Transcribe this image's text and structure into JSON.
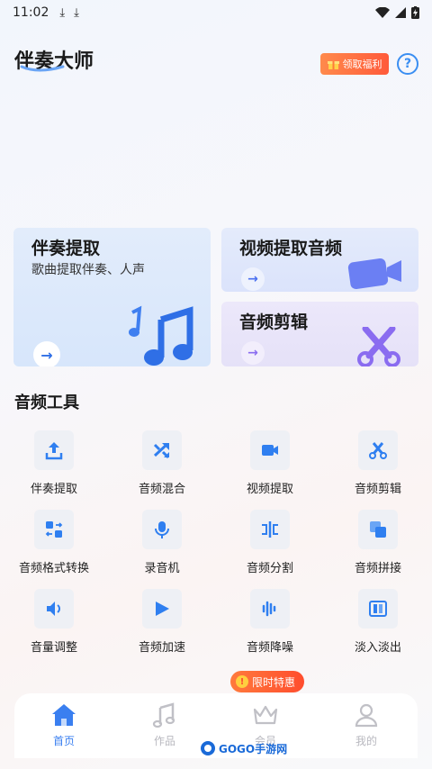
{
  "status_bar": {
    "time": "11:02"
  },
  "header": {
    "title": "伴奏大师",
    "welfare_label": "领取福利",
    "help_label": "?"
  },
  "feature_cards": [
    {
      "title": "伴奏提取",
      "subtitle": "歌曲提取伴奏、人声"
    },
    {
      "title": "视频提取音频"
    },
    {
      "title": "音频剪辑"
    }
  ],
  "tools_section": {
    "title": "音频工具",
    "items": [
      {
        "label": "伴奏提取",
        "icon": "upload-icon"
      },
      {
        "label": "音频混合",
        "icon": "shuffle-icon"
      },
      {
        "label": "视频提取",
        "icon": "video-camera-icon"
      },
      {
        "label": "音频剪辑",
        "icon": "scissors-icon"
      },
      {
        "label": "音频格式转换",
        "icon": "format-convert-icon"
      },
      {
        "label": "录音机",
        "icon": "microphone-icon"
      },
      {
        "label": "音频分割",
        "icon": "split-icon"
      },
      {
        "label": "音频拼接",
        "icon": "merge-icon"
      },
      {
        "label": "音量调整",
        "icon": "volume-icon"
      },
      {
        "label": "音频加速",
        "icon": "speed-icon"
      },
      {
        "label": "音频降噪",
        "icon": "denoise-icon"
      },
      {
        "label": "淡入淡出",
        "icon": "fade-icon"
      }
    ]
  },
  "promo_badge": "限时特惠",
  "tab_bar": [
    {
      "label": "首页",
      "icon": "home-icon",
      "active": true
    },
    {
      "label": "作品",
      "icon": "music-note-icon",
      "active": false
    },
    {
      "label": "会员",
      "icon": "crown-icon",
      "active": false
    },
    {
      "label": "我的",
      "icon": "user-icon",
      "active": false
    }
  ],
  "watermark": "GOGO手游网",
  "colors": {
    "accent": "#3a7ff0",
    "promo": "#ff5a3a",
    "icon_blue": "#2f6fe6"
  }
}
